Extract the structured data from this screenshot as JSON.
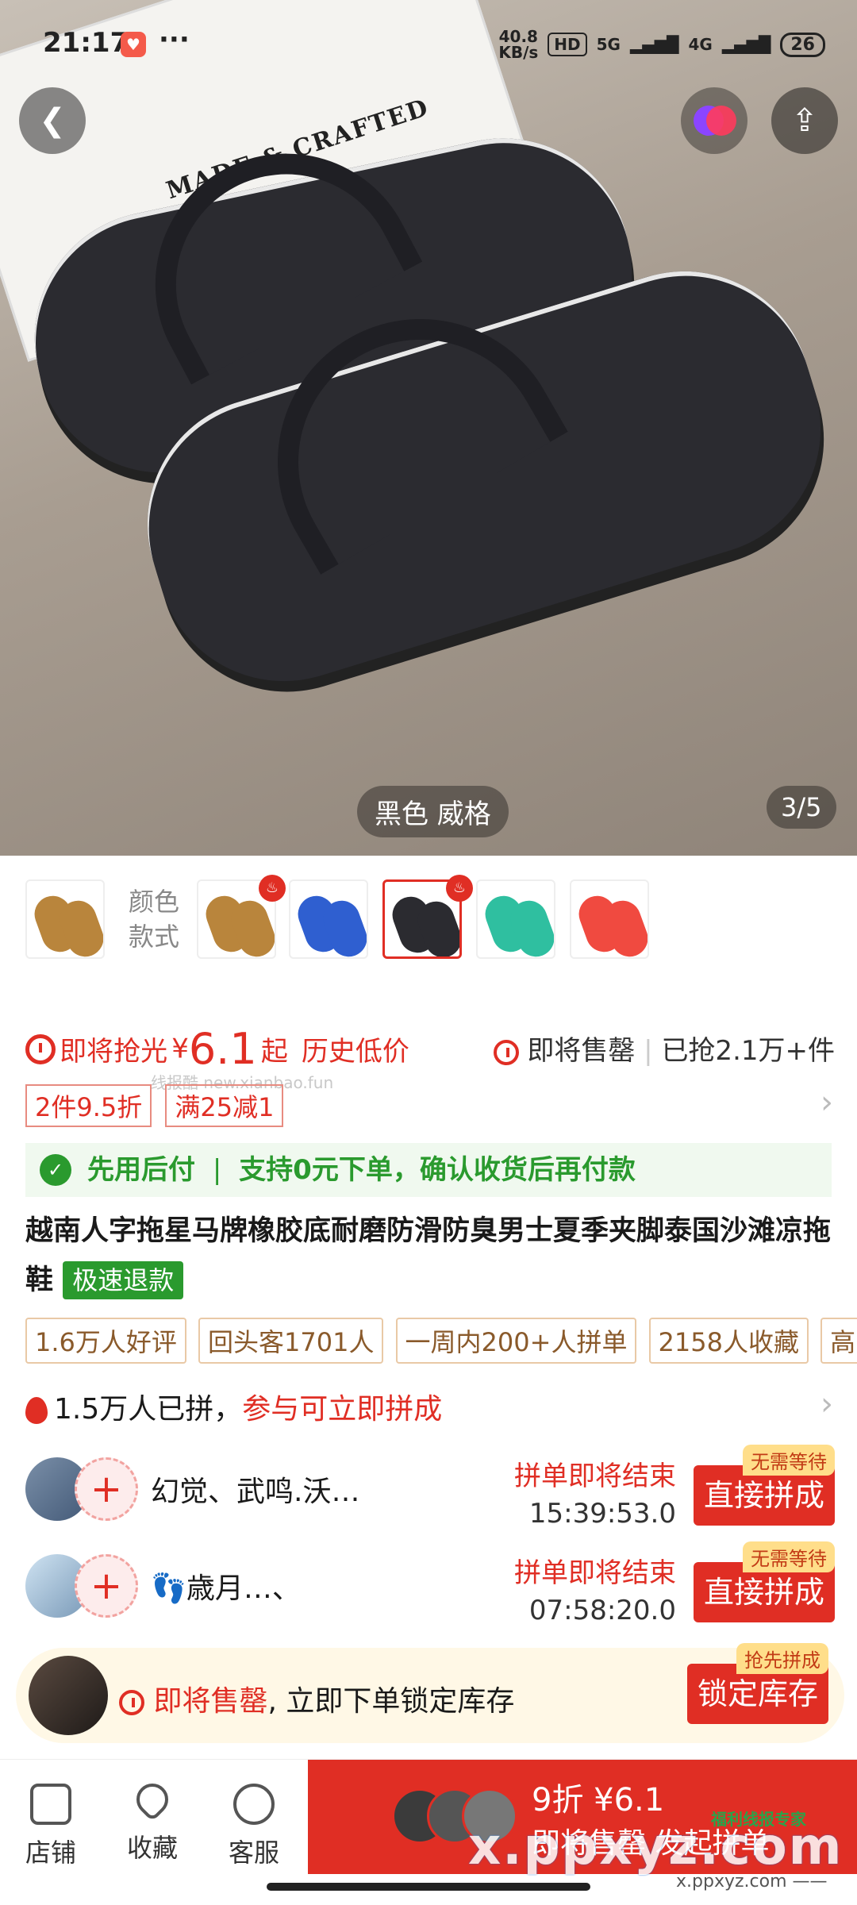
{
  "status_bar": {
    "time": "21:17",
    "more": "···",
    "net_speed": "40.8",
    "net_unit": "KB/s",
    "hd": "HD",
    "sig5g": "5G",
    "sig4g": "4G",
    "battery": "26"
  },
  "gallery": {
    "box_text": "MADE & CRAFTED",
    "color_label": "黑色 威格",
    "pager": "3/5"
  },
  "variants": {
    "style_label_1": "颜色",
    "style_label_2": "款式",
    "colors": [
      "#b9853c",
      "#b9853c",
      "#2f5fd0",
      "#2b2b30",
      "#2fbfa0",
      "#f04a40"
    ]
  },
  "promo": {
    "soon": "即将抢光",
    "currency": "¥",
    "price": "6.1",
    "from": "起",
    "history_low": "历史低价",
    "selling_out": "即将售罄",
    "sold": "已抢2.1万+件",
    "watermark": "线报酷 new.xianbao.fun",
    "coupons": [
      "2件9.5折",
      "满25减1"
    ]
  },
  "pay_later": {
    "label": "先用后付",
    "sep": "|",
    "desc": "支持0元下单，确认收货后再付款"
  },
  "product": {
    "title": "越南人字拖星马牌橡胶底耐磨防滑防臭男士夏季夹脚泰国沙滩凉拖鞋",
    "refund_tag": "极速退款"
  },
  "stats": [
    "1.6万人好评",
    "回头客1701人",
    "一周内200+人拼单",
    "2158人收藏",
    "高"
  ],
  "groups": {
    "joined_count": "1.5万人已拼，",
    "join_hint": "参与可立即拼成",
    "items": [
      {
        "name": "幻觉、武鸣.沃…",
        "end_label": "拼单即将结束",
        "countdown": "15:39:53.0",
        "tag": "无需等待",
        "button": "直接拼成"
      },
      {
        "name": "👣歳月…、",
        "end_label": "拼单即将结束",
        "countdown": "07:58:20.0",
        "tag": "无需等待",
        "button": "直接拼成"
      }
    ]
  },
  "lock": {
    "soon": "即将售罄",
    "text": ", 立即下单锁定库存",
    "tag": "抢先拼成",
    "button": "锁定库存"
  },
  "bottom_bar": {
    "store": "店铺",
    "favorite": "收藏",
    "service": "客服",
    "buy_line1": "9折 ¥6.1",
    "buy_line2": "即将售罄 发起拼单"
  },
  "overlay_marks": {
    "site": "x.ppxyz.com",
    "site_small": "x.ppxyz.com ——",
    "expert": "福利线报专家"
  }
}
